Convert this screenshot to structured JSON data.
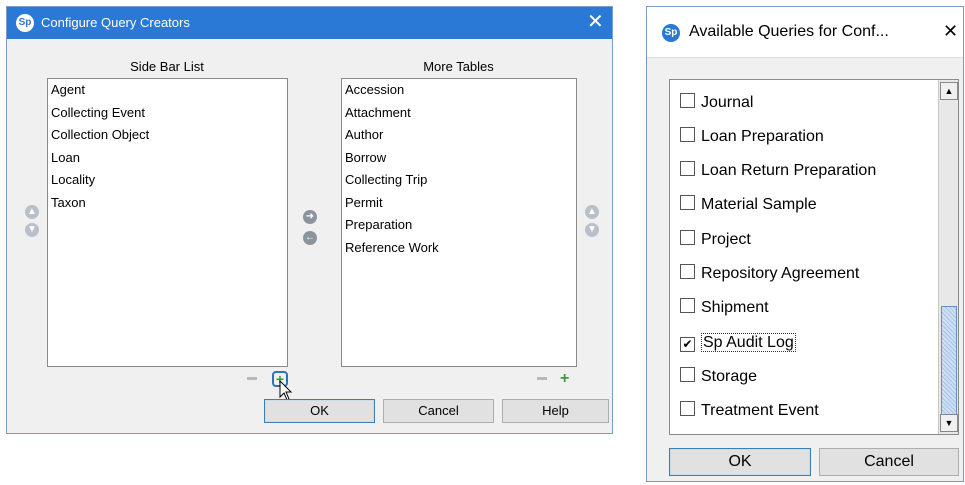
{
  "dialog1": {
    "title": "Configure Query Creators",
    "app_icon": "Sp",
    "close_glyph": "✕",
    "sidebar": {
      "header": "Side Bar List",
      "items": [
        "Agent",
        "Collecting Event",
        "Collection Object",
        "Loan",
        "Locality",
        "Taxon"
      ]
    },
    "more_tables": {
      "header": "More Tables",
      "items": [
        "Accession",
        "Attachment",
        "Author",
        "Borrow",
        "Collecting Trip",
        "Permit",
        "Preparation",
        "Reference Work"
      ]
    },
    "buttons": {
      "ok": "OK",
      "cancel": "Cancel",
      "help": "Help"
    },
    "glyphs": {
      "up": "▲",
      "down": "▼",
      "right": "➜",
      "left": "←",
      "plus": "+"
    }
  },
  "dialog2": {
    "title": "Available Queries for Conf...",
    "app_icon": "Sp",
    "close_glyph": "✕",
    "items": [
      {
        "label": "Journal",
        "checked": false
      },
      {
        "label": "Loan Preparation",
        "checked": false
      },
      {
        "label": "Loan Return Preparation",
        "checked": false
      },
      {
        "label": "Material Sample",
        "checked": false
      },
      {
        "label": "Project",
        "checked": false
      },
      {
        "label": "Repository Agreement",
        "checked": false
      },
      {
        "label": "Shipment",
        "checked": false
      },
      {
        "label": "Sp Audit Log",
        "checked": true
      },
      {
        "label": "Storage",
        "checked": false
      },
      {
        "label": "Treatment Event",
        "checked": false
      }
    ],
    "buttons": {
      "ok": "OK",
      "cancel": "Cancel"
    },
    "scroll_glyphs": {
      "up": "▲",
      "down": "▼"
    },
    "check_glyph": "✔"
  },
  "colors": {
    "titlebar": "#2b79d6",
    "dialog_bg": "#f0f0f0",
    "plus_green": "#3a9b3a"
  }
}
